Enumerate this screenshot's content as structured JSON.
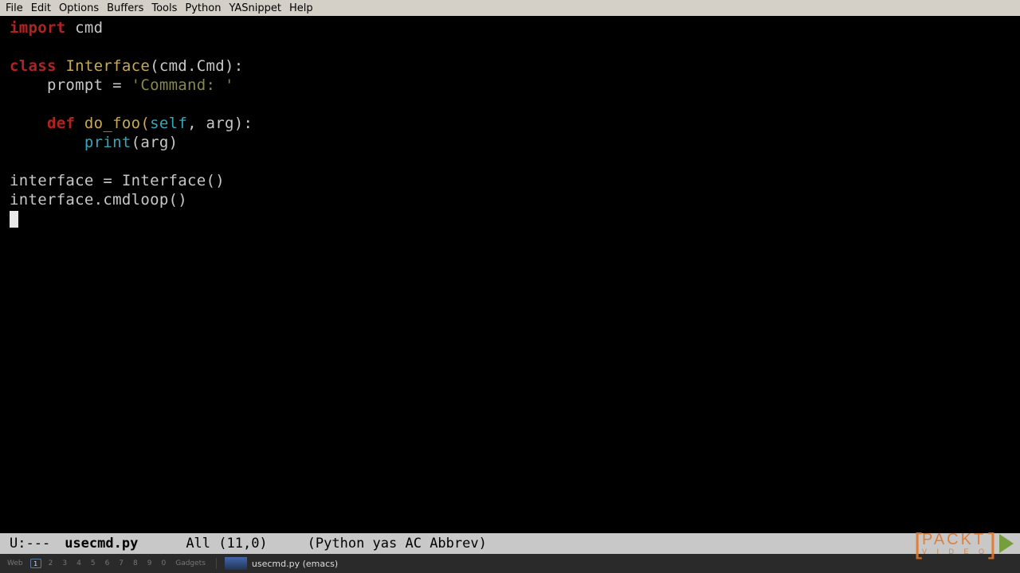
{
  "menubar": {
    "items": [
      "File",
      "Edit",
      "Options",
      "Buffers",
      "Tools",
      "Python",
      "YASnippet",
      "Help"
    ]
  },
  "code": {
    "l1_kw": "import",
    "l1_mod": " cmd",
    "l3_kw": "class",
    "l3_name": " Interface",
    "l3_rest": "(cmd.Cmd):",
    "l4_indent": "    prompt = ",
    "l4_str": "'Command: '",
    "l6_indent": "    ",
    "l6_kw": "def",
    "l6_name": " do_foo(",
    "l6_self": "self",
    "l6_rest": ", arg):",
    "l7_indent": "        ",
    "l7_print": "print",
    "l7_rest": "(arg)",
    "l9": "interface = Interface()",
    "l10": "interface.cmdloop()"
  },
  "modeline": {
    "status": "U:---",
    "buffer": "usecmd.py",
    "position": "All  (11,0)",
    "modes": "(Python yas AC Abbrev)"
  },
  "taskbar": {
    "web": "Web",
    "ws_active": "1",
    "ws_others": [
      "2",
      "3",
      "4",
      "5",
      "6",
      "7",
      "8",
      "9",
      "0"
    ],
    "gadgets": "Gadgets",
    "app": "usecmd.py (emacs)"
  },
  "watermark": {
    "main": "PACKT",
    "sub": "V I D E O"
  }
}
